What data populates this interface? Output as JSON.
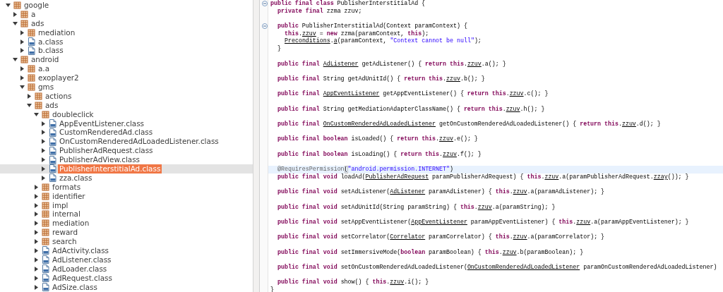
{
  "package_tree": {
    "nodes": [
      {
        "label": "google",
        "kind": "package",
        "expanded": true,
        "selected": false,
        "children": [
          {
            "label": "a",
            "kind": "package",
            "expanded": false,
            "selected": false
          },
          {
            "label": "ads",
            "kind": "package",
            "expanded": true,
            "selected": false,
            "children": [
              {
                "label": "mediation",
                "kind": "package",
                "expanded": false,
                "selected": false
              },
              {
                "label": "a.class",
                "kind": "class",
                "expanded": false,
                "selected": false
              },
              {
                "label": "b.class",
                "kind": "class",
                "expanded": false,
                "selected": false
              }
            ]
          },
          {
            "label": "android",
            "kind": "package",
            "expanded": true,
            "selected": false,
            "children": [
              {
                "label": "a.a",
                "kind": "package",
                "expanded": false,
                "selected": false
              },
              {
                "label": "exoplayer2",
                "kind": "package",
                "expanded": false,
                "selected": false
              },
              {
                "label": "gms",
                "kind": "package",
                "expanded": true,
                "selected": false,
                "children": [
                  {
                    "label": "actions",
                    "kind": "package",
                    "expanded": false,
                    "selected": false
                  },
                  {
                    "label": "ads",
                    "kind": "package",
                    "expanded": true,
                    "selected": false,
                    "children": [
                      {
                        "label": "doubleclick",
                        "kind": "package",
                        "expanded": true,
                        "selected": false,
                        "children": [
                          {
                            "label": "AppEventListener.class",
                            "kind": "class",
                            "expanded": false,
                            "selected": false
                          },
                          {
                            "label": "CustomRenderedAd.class",
                            "kind": "class",
                            "expanded": false,
                            "selected": false
                          },
                          {
                            "label": "OnCustomRenderedAdLoadedListener.class",
                            "kind": "class",
                            "expanded": false,
                            "selected": false
                          },
                          {
                            "label": "PublisherAdRequest.class",
                            "kind": "class",
                            "expanded": false,
                            "selected": false
                          },
                          {
                            "label": "PublisherAdView.class",
                            "kind": "class",
                            "expanded": false,
                            "selected": false
                          },
                          {
                            "label": "PublisherInterstitialAd.class",
                            "kind": "class",
                            "expanded": false,
                            "selected": true
                          },
                          {
                            "label": "zza.class",
                            "kind": "class",
                            "expanded": false,
                            "selected": false
                          }
                        ]
                      },
                      {
                        "label": "formats",
                        "kind": "package",
                        "expanded": false,
                        "selected": false
                      },
                      {
                        "label": "identifier",
                        "kind": "package",
                        "expanded": false,
                        "selected": false
                      },
                      {
                        "label": "impl",
                        "kind": "package",
                        "expanded": false,
                        "selected": false
                      },
                      {
                        "label": "internal",
                        "kind": "package",
                        "expanded": false,
                        "selected": false
                      },
                      {
                        "label": "mediation",
                        "kind": "package",
                        "expanded": false,
                        "selected": false
                      },
                      {
                        "label": "reward",
                        "kind": "package",
                        "expanded": false,
                        "selected": false
                      },
                      {
                        "label": "search",
                        "kind": "package",
                        "expanded": false,
                        "selected": false
                      },
                      {
                        "label": "AdActivity.class",
                        "kind": "class",
                        "expanded": false,
                        "selected": false
                      },
                      {
                        "label": "AdListener.class",
                        "kind": "class",
                        "expanded": false,
                        "selected": false
                      },
                      {
                        "label": "AdLoader.class",
                        "kind": "class",
                        "expanded": false,
                        "selected": false
                      },
                      {
                        "label": "AdRequest.class",
                        "kind": "class",
                        "expanded": false,
                        "selected": false
                      },
                      {
                        "label": "AdSize.class",
                        "kind": "class",
                        "expanded": false,
                        "selected": false
                      }
                    ]
                  }
                ]
              }
            ]
          }
        ]
      }
    ]
  },
  "code_editor": {
    "lines": [
      {
        "foldable": true,
        "current": false,
        "tokens": [
          {
            "kind": "keyword",
            "text": "public final class"
          },
          {
            "kind": "plain",
            "text": " PublisherInterstitialAd {"
          }
        ],
        "children": [
          {
            "current": false,
            "tokens": [
              {
                "kind": "keyword",
                "text": "private final"
              },
              {
                "kind": "plain",
                "text": " zzma zzuv;"
              }
            ]
          },
          {
            "gap_before": true,
            "foldable": true,
            "current": false,
            "tokens": [
              {
                "kind": "keyword",
                "text": "public"
              },
              {
                "kind": "plain",
                "text": " PublisherInterstitialAd(Context paramContext) {"
              }
            ],
            "children": [
              {
                "current": false,
                "tokens": [
                  {
                    "kind": "keyword",
                    "text": "this"
                  },
                  {
                    "kind": "plain",
                    "text": "."
                  },
                  {
                    "kind": "link",
                    "text": "zzuv"
                  },
                  {
                    "kind": "plain",
                    "text": " = "
                  },
                  {
                    "kind": "keyword",
                    "text": "new"
                  },
                  {
                    "kind": "plain",
                    "text": " zzma(paramContext, "
                  },
                  {
                    "kind": "keyword",
                    "text": "this"
                  },
                  {
                    "kind": "plain",
                    "text": ");"
                  }
                ]
              },
              {
                "current": false,
                "tokens": [
                  {
                    "kind": "link",
                    "text": "Preconditions"
                  },
                  {
                    "kind": "plain",
                    "text": "."
                  },
                  {
                    "kind": "link",
                    "text": "a"
                  },
                  {
                    "kind": "plain",
                    "text": "(paramContext, "
                  },
                  {
                    "kind": "string",
                    "text": "\"Context cannot be null\""
                  },
                  {
                    "kind": "plain",
                    "text": ");"
                  }
                ]
              }
            ]
          },
          {
            "current": false,
            "tokens": [
              {
                "kind": "plain",
                "text": "}"
              }
            ]
          },
          {
            "gap_before": true,
            "current": false,
            "tokens": [
              {
                "kind": "keyword",
                "text": "public final"
              },
              {
                "kind": "link",
                "text": "AdListener"
              },
              {
                "kind": "plain",
                "text": "getAdListener() {"
              },
              {
                "kind": "keyword",
                "text": "return this"
              },
              {
                "kind": "plain",
                "text": "."
              },
              {
                "kind": "link",
                "text": "zzuv"
              },
              {
                "kind": "plain",
                "text": ".a(); }"
              }
            ]
          },
          {
            "gap_before": true,
            "current": false,
            "tokens": [
              {
                "kind": "keyword",
                "text": "public final"
              },
              {
                "kind": "plain",
                "text": "String getAdUnitId() {"
              },
              {
                "kind": "keyword",
                "text": "return this"
              },
              {
                "kind": "plain",
                "text": "."
              },
              {
                "kind": "link",
                "text": "zzuv"
              },
              {
                "kind": "plain",
                "text": ".b(); }"
              }
            ]
          },
          {
            "gap_before": true,
            "current": false,
            "tokens": [
              {
                "kind": "keyword",
                "text": "public final"
              },
              {
                "kind": "link",
                "text": "AppEventListener"
              },
              {
                "kind": "plain",
                "text": "getAppEventListener() {"
              },
              {
                "kind": "keyword",
                "text": "return this"
              },
              {
                "kind": "plain",
                "text": "."
              },
              {
                "kind": "link",
                "text": "zzuv"
              },
              {
                "kind": "plain",
                "text": ".c(); }"
              }
            ]
          },
          {
            "gap_before": true,
            "current": false,
            "tokens": [
              {
                "kind": "keyword",
                "text": "public final"
              },
              {
                "kind": "plain",
                "text": "String getMediationAdapterClassName() {"
              },
              {
                "kind": "keyword",
                "text": "return this"
              },
              {
                "kind": "plain",
                "text": "."
              },
              {
                "kind": "link",
                "text": "zzuv"
              },
              {
                "kind": "plain",
                "text": ".h(); }"
              }
            ]
          },
          {
            "gap_before": true,
            "current": false,
            "tokens": [
              {
                "kind": "keyword",
                "text": "public final"
              },
              {
                "kind": "link",
                "text": "OnCustomRenderedAdLoadedListener"
              },
              {
                "kind": "plain",
                "text": "getOnCustomRenderedAdLoadedListener() {"
              },
              {
                "kind": "keyword",
                "text": "return this"
              },
              {
                "kind": "plain",
                "text": "."
              },
              {
                "kind": "link",
                "text": "zzuv"
              },
              {
                "kind": "plain",
                "text": ".d(); }"
              }
            ]
          },
          {
            "gap_before": true,
            "current": false,
            "tokens": [
              {
                "kind": "keyword",
                "text": "public final boolean"
              },
              {
                "kind": "plain",
                "text": "isLoaded() {"
              },
              {
                "kind": "keyword",
                "text": "return this"
              },
              {
                "kind": "plain",
                "text": "."
              },
              {
                "kind": "link",
                "text": "zzuv"
              },
              {
                "kind": "plain",
                "text": ".e(); }"
              }
            ]
          },
          {
            "gap_before": true,
            "current": false,
            "tokens": [
              {
                "kind": "keyword",
                "text": "public final boolean"
              },
              {
                "kind": "plain",
                "text": "isLoading() {"
              },
              {
                "kind": "keyword",
                "text": "return this"
              },
              {
                "kind": "plain",
                "text": "."
              },
              {
                "kind": "link",
                "text": "zzuv"
              },
              {
                "kind": "plain",
                "text": ".f(); }"
              }
            ]
          },
          {
            "gap_before": true,
            "current": true,
            "tokens": [
              {
                "kind": "annotation",
                "text": "@RequiresPermission"
              },
              {
                "kind": "bracket",
                "text": "("
              },
              {
                "kind": "string",
                "text": "\"android.permission.INTERNET\""
              },
              {
                "kind": "plain",
                "text": ")"
              }
            ]
          },
          {
            "current": false,
            "tokens": [
              {
                "kind": "keyword",
                "text": "public final void"
              },
              {
                "kind": "plain",
                "text": "loadAd("
              },
              {
                "kind": "link",
                "text": "PublisherAdRequest"
              },
              {
                "kind": "plain",
                "text": "paramPublisherAdRequest) {"
              },
              {
                "kind": "keyword",
                "text": "this"
              },
              {
                "kind": "plain",
                "text": "."
              },
              {
                "kind": "link",
                "text": "zzuv"
              },
              {
                "kind": "plain",
                "text": ".a(paramPublisherAdRequest."
              },
              {
                "kind": "link",
                "text": "zzay"
              },
              {
                "kind": "plain",
                "text": "()); }"
              }
            ]
          },
          {
            "gap_before": true,
            "current": false,
            "tokens": [
              {
                "kind": "keyword",
                "text": "public final void"
              },
              {
                "kind": "plain",
                "text": "setAdListener("
              },
              {
                "kind": "link",
                "text": "AdListener"
              },
              {
                "kind": "plain",
                "text": "paramAdListener) {"
              },
              {
                "kind": "keyword",
                "text": "this"
              },
              {
                "kind": "plain",
                "text": "."
              },
              {
                "kind": "link",
                "text": "zzuv"
              },
              {
                "kind": "plain",
                "text": ".a(paramAdListener); }"
              }
            ]
          },
          {
            "gap_before": true,
            "current": false,
            "tokens": [
              {
                "kind": "keyword",
                "text": "public final void"
              },
              {
                "kind": "plain",
                "text": "setAdUnitId(String paramString) {"
              },
              {
                "kind": "keyword",
                "text": "this"
              },
              {
                "kind": "plain",
                "text": "."
              },
              {
                "kind": "link",
                "text": "zzuv"
              },
              {
                "kind": "plain",
                "text": ".a(paramString); }"
              }
            ]
          },
          {
            "gap_before": true,
            "current": false,
            "tokens": [
              {
                "kind": "keyword",
                "text": "public final void"
              },
              {
                "kind": "plain",
                "text": "setAppEventListener("
              },
              {
                "kind": "link",
                "text": "AppEventListener"
              },
              {
                "kind": "plain",
                "text": "paramAppEventListener) {"
              },
              {
                "kind": "keyword",
                "text": "this"
              },
              {
                "kind": "plain",
                "text": "."
              },
              {
                "kind": "link",
                "text": "zzuv"
              },
              {
                "kind": "plain",
                "text": ".a(paramAppEventListener); }"
              }
            ]
          },
          {
            "gap_before": true,
            "current": false,
            "tokens": [
              {
                "kind": "keyword",
                "text": "public final void"
              },
              {
                "kind": "plain",
                "text": "setCorrelator("
              },
              {
                "kind": "link",
                "text": "Correlator"
              },
              {
                "kind": "plain",
                "text": "paramCorrelator) {"
              },
              {
                "kind": "keyword",
                "text": "this"
              },
              {
                "kind": "plain",
                "text": "."
              },
              {
                "kind": "link",
                "text": "zzuv"
              },
              {
                "kind": "plain",
                "text": ".a(paramCorrelator); }"
              }
            ]
          },
          {
            "gap_before": true,
            "current": false,
            "tokens": [
              {
                "kind": "keyword",
                "text": "public final void"
              },
              {
                "kind": "plain",
                "text": "setImmersiveMode("
              },
              {
                "kind": "keyword",
                "text": "boolean"
              },
              {
                "kind": "plain",
                "text": "paramBoolean) {"
              },
              {
                "kind": "keyword",
                "text": "this"
              },
              {
                "kind": "plain",
                "text": "."
              },
              {
                "kind": "link",
                "text": "zzuv"
              },
              {
                "kind": "plain",
                "text": ".b(paramBoolean); }"
              }
            ]
          },
          {
            "gap_before": true,
            "current": false,
            "tokens": [
              {
                "kind": "keyword",
                "text": "public final void"
              },
              {
                "kind": "plain",
                "text": "setOnCustomRenderedAdLoadedListener("
              },
              {
                "kind": "link",
                "text": "OnCustomRenderedAdLoadedListener"
              },
              {
                "kind": "plain",
                "text": "paramOnCustomRenderedAdLoadedListener)"
              }
            ]
          },
          {
            "gap_before": true,
            "current": false,
            "tokens": [
              {
                "kind": "keyword",
                "text": "public final void"
              },
              {
                "kind": "plain",
                "text": "show() {"
              },
              {
                "kind": "keyword",
                "text": "this"
              },
              {
                "kind": "plain",
                "text": "."
              },
              {
                "kind": "link",
                "text": "zzuv"
              },
              {
                "kind": "plain",
                "text": ".i(); }"
              }
            ]
          }
        ]
      },
      {
        "current": false,
        "tokens": [
          {
            "kind": "plain",
            "text": "}"
          }
        ]
      }
    ]
  }
}
